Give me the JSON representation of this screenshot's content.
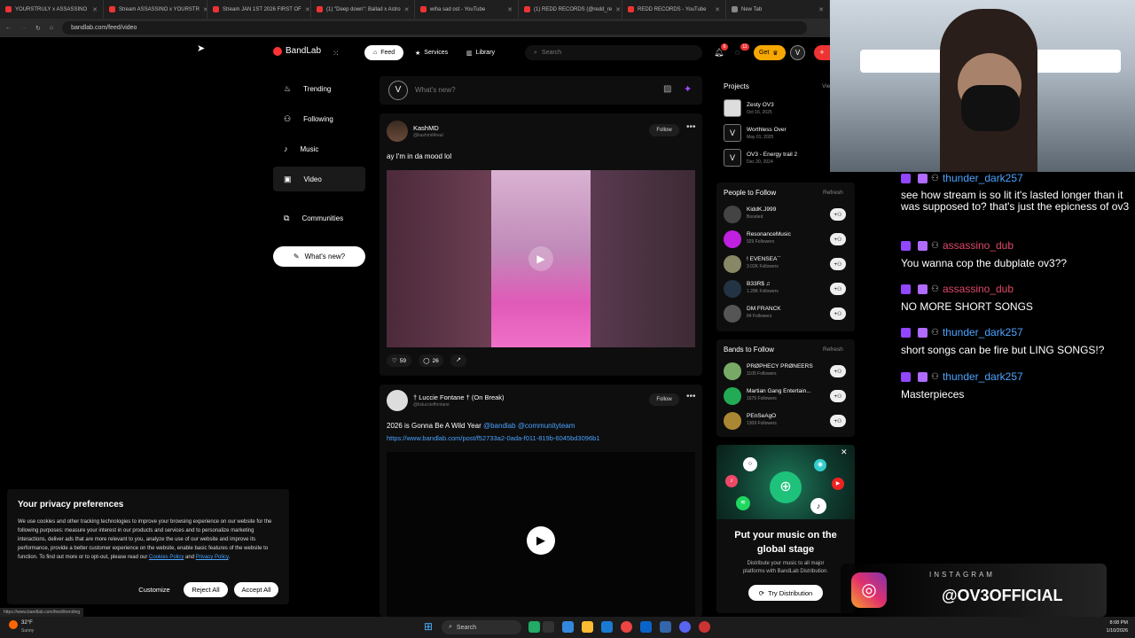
{
  "browser": {
    "tabs": [
      {
        "label": "YOURSTRULY x ASSASSINO",
        "color": "#e33"
      },
      {
        "label": "Stream ASSASSINO x YOURSTR",
        "color": "#e33"
      },
      {
        "label": "Stream JAN 1ST 2026 FIRST OF",
        "color": "#e33"
      },
      {
        "label": "(1) \"Deep down\": Ballad x Astro",
        "color": "#e33"
      },
      {
        "label": "wiha sad ost - YouTube",
        "color": "#e33"
      },
      {
        "label": "(1) REDD RECORDS (@redd_re",
        "color": "#e33"
      },
      {
        "label": "REDD RECORDS - YouTube",
        "color": "#e33"
      },
      {
        "label": "New Tab",
        "color": "#888"
      }
    ],
    "address": "bandlab.com/feed/video",
    "status_url": "https://www.bandlab.com/feed/trending"
  },
  "header": {
    "logo": "BandLab",
    "feed": "Feed",
    "services": "Services",
    "library": "Library",
    "search_placeholder": "Search",
    "get_label": "Get",
    "notif_count": "6",
    "msg_count": "11"
  },
  "nav": {
    "trending": "Trending",
    "following": "Following",
    "music": "Music",
    "video": "Video",
    "communities": "Communities",
    "whats_new_button": "What's new?"
  },
  "composer": {
    "placeholder": "What's new?"
  },
  "posts": [
    {
      "name": "KashMD",
      "handle": "@kashmd4real",
      "follow": "Follow",
      "text": "ay I'm in da mood lol",
      "likes": "59",
      "comments": "26"
    },
    {
      "name": "† Luccie Fontane † (On Break)",
      "handle": "@itsluccieffontane",
      "follow": "Follow",
      "text": "2026 is Gonna Be A Wild Year",
      "mention1": "@bandlab",
      "mention2": "@communityteam",
      "url": "https://www.bandlab.com/post/f52733a2-0ada-f011-819b-6045bd3096b1"
    }
  ],
  "projects": {
    "title": "Projects",
    "view": "Vie",
    "items": [
      {
        "name": "Zesty OV3",
        "date": "Oct 16, 2025"
      },
      {
        "name": "Worthless Over",
        "date": "May 01, 2025"
      },
      {
        "name": "OV3 - Energy trail 2",
        "date": "Dec 20, 2024"
      }
    ]
  },
  "people": {
    "title": "People to Follow",
    "refresh": "Refresh",
    "items": [
      {
        "name": "KiddK.J999",
        "sub": "Boosted"
      },
      {
        "name": "ResonanceMusic",
        "sub": "929 Followers"
      },
      {
        "name": "! EVENSEA´´",
        "sub": "3.02K Followers"
      },
      {
        "name": "B33R$ ♫",
        "sub": "1.28K Followers"
      },
      {
        "name": "DM FRANCK",
        "sub": "84 Followers"
      }
    ]
  },
  "bands": {
    "title": "Bands to Follow",
    "refresh": "Refresh",
    "items": [
      {
        "name": "PRØPHECY PRØNEERS",
        "sub": "1105 Followers"
      },
      {
        "name": "Martian Gang Entertain...",
        "sub": "1675 Followers"
      },
      {
        "name": "PEnSeAgO",
        "sub": "1309 Followers"
      }
    ]
  },
  "promo": {
    "title_line1": "Put your music on the",
    "title_line2": "global stage",
    "body_line1": "Distribute your music to all major",
    "body_line2": "platforms with BandLab Distribution.",
    "cta": "Try Distribution"
  },
  "privacy": {
    "title": "Your privacy preferences",
    "body": "We use cookies and other tracking technologies to improve your browsing experience on our website for the following purposes: measure your interest in our products and services and to personalize marketing interactions, deliver ads that are more relevant to you, analyze the use of our website and improve its performance, provide a better customer experience on the website, enable basic features of the website to function. To find out more or to opt-out, please read our",
    "cookies_link": "Cookies Policy",
    "and": "and",
    "privacy_link": "Privacy Policy",
    "customize": "Customize",
    "reject": "Reject All",
    "accept": "Accept All"
  },
  "chat": [
    {
      "user": "thunder_dark257",
      "color": "#4da3ff",
      "msg": "see how stream is so lit it's lasted longer than it was supposed to? that's just the epicness of ov3"
    },
    {
      "user": "assassino_dub",
      "color": "#e04868",
      "msg": "You wanna cop the dubplate ov3??"
    },
    {
      "user": "assassino_dub",
      "color": "#e04868",
      "msg": "NO MORE SHORT SONGS"
    },
    {
      "user": "thunder_dark257",
      "color": "#4da3ff",
      "msg": "short songs can be fire but LING SONGS!?"
    },
    {
      "user": "thunder_dark257",
      "color": "#4da3ff",
      "msg": "Masterpieces"
    }
  ],
  "overlay": {
    "instagram_label": "INSTAGRAM",
    "handle": "@OV3OFFICIAL"
  },
  "taskbar": {
    "weather_temp": "32°F",
    "weather_desc": "Sunny",
    "search": "Search",
    "time": "8:08 PM",
    "date": "1/10/2026"
  }
}
